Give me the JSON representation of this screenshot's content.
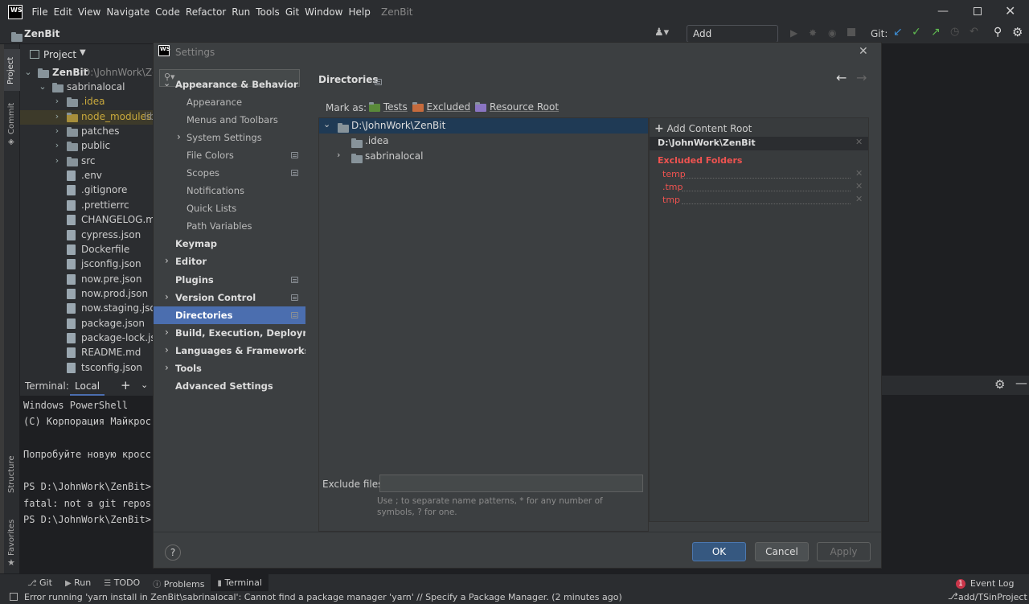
{
  "titlebar": {
    "logo": "WS",
    "menus": [
      "File",
      "Edit",
      "View",
      "Navigate",
      "Code",
      "Refactor",
      "Run",
      "Tools",
      "Git",
      "Window",
      "Help"
    ],
    "app": "ZenBit"
  },
  "toolbar": {
    "project": "ZenBit",
    "add_config": "Add Configuration...",
    "git_label": "Git:"
  },
  "sidebar_tabs": {
    "project": "Project",
    "commit": "Commit",
    "structure": "Structure",
    "favorites": "Favorites"
  },
  "project": {
    "header": "Project",
    "root": "ZenBit",
    "root_path": "D:\\JohnWork\\Zen",
    "items": [
      {
        "name": "sabrinalocal",
        "type": "folder",
        "level": 1
      },
      {
        "name": ".idea",
        "type": "folder",
        "level": 2
      },
      {
        "name": "node_modules",
        "suffix": "libr",
        "type": "folder",
        "level": 2
      },
      {
        "name": "patches",
        "type": "folder",
        "level": 2
      },
      {
        "name": "public",
        "type": "folder",
        "level": 2
      },
      {
        "name": "src",
        "type": "folder",
        "level": 2
      },
      {
        "name": ".env",
        "type": "file",
        "level": 2
      },
      {
        "name": ".gitignore",
        "type": "file",
        "level": 2
      },
      {
        "name": ".prettierrc",
        "type": "file",
        "level": 2
      },
      {
        "name": "CHANGELOG.md",
        "type": "file",
        "level": 2
      },
      {
        "name": "cypress.json",
        "type": "file",
        "level": 2
      },
      {
        "name": "Dockerfile",
        "type": "file",
        "level": 2
      },
      {
        "name": "jsconfig.json",
        "type": "file",
        "level": 2
      },
      {
        "name": "now.pre.json",
        "type": "file",
        "level": 2
      },
      {
        "name": "now.prod.json",
        "type": "file",
        "level": 2
      },
      {
        "name": "now.staging.json",
        "type": "file",
        "level": 2
      },
      {
        "name": "package.json",
        "type": "file",
        "level": 2
      },
      {
        "name": "package-lock.json",
        "type": "file",
        "level": 2
      },
      {
        "name": "README.md",
        "type": "file",
        "level": 2
      },
      {
        "name": "tsconfig.json",
        "type": "file",
        "level": 2
      }
    ]
  },
  "terminal": {
    "label": "Terminal:",
    "tab": "Local",
    "lines": [
      "Windows PowerShell",
      "(С) Корпорация Майкрос",
      "",
      "Попробуйте новую кросс",
      "",
      "PS D:\\JohnWork\\ZenBit>",
      "fatal: not a git repos",
      "PS D:\\JohnWork\\ZenBit>"
    ]
  },
  "settings": {
    "title": "Settings",
    "logo": "WS",
    "search_placeholder": "Q▾",
    "nav": [
      {
        "label": "Appearance & Behavior",
        "bold": true,
        "expanded": true,
        "level": 0
      },
      {
        "label": "Appearance",
        "level": 1
      },
      {
        "label": "Menus and Toolbars",
        "level": 1
      },
      {
        "label": "System Settings",
        "level": 1,
        "collapsed": true
      },
      {
        "label": "File Colors",
        "level": 1,
        "badge": true
      },
      {
        "label": "Scopes",
        "level": 1,
        "badge": true
      },
      {
        "label": "Notifications",
        "level": 1
      },
      {
        "label": "Quick Lists",
        "level": 1
      },
      {
        "label": "Path Variables",
        "level": 1
      },
      {
        "label": "Keymap",
        "bold": true,
        "level": 0
      },
      {
        "label": "Editor",
        "bold": true,
        "level": 0,
        "collapsed": true
      },
      {
        "label": "Plugins",
        "bold": true,
        "level": 0,
        "badge": true
      },
      {
        "label": "Version Control",
        "bold": true,
        "level": 0,
        "collapsed": true,
        "badge": true
      },
      {
        "label": "Directories",
        "bold": true,
        "level": 0,
        "selected": true,
        "badge": true
      },
      {
        "label": "Build, Execution, Deployment",
        "bold": true,
        "level": 0,
        "collapsed": true
      },
      {
        "label": "Languages & Frameworks",
        "bold": true,
        "level": 0,
        "collapsed": true
      },
      {
        "label": "Tools",
        "bold": true,
        "level": 0,
        "collapsed": true
      },
      {
        "label": "Advanced Settings",
        "bold": true,
        "level": 0
      }
    ],
    "page_title": "Directories",
    "mark_as": "Mark as:",
    "marks": [
      {
        "label": "Tests",
        "color": "#5a8a3a"
      },
      {
        "label": "Excluded",
        "color": "#c66b3d"
      },
      {
        "label": "Resource Root",
        "color": "#8a75c2"
      }
    ],
    "tree": {
      "root": "D:\\JohnWork\\ZenBit",
      "children": [
        ".idea",
        "sabrinalocal"
      ]
    },
    "add_root": "Add Content Root",
    "content_root": "D:\\JohnWork\\ZenBit",
    "excluded_header": "Excluded Folders",
    "excluded": [
      "temp",
      ".tmp",
      "tmp"
    ],
    "exclude_files_label": "Exclude files:",
    "exclude_files_value": "",
    "hint": "Use ; to separate name patterns, * for any number of symbols, ? for one.",
    "ok": "OK",
    "cancel": "Cancel",
    "apply": "Apply",
    "help": "?"
  },
  "bottom_tabs": [
    {
      "label": "Git"
    },
    {
      "label": "Run"
    },
    {
      "label": "TODO"
    },
    {
      "label": "Problems"
    },
    {
      "label": "Terminal",
      "active": true
    }
  ],
  "event_log": {
    "count": "1",
    "label": "Event Log"
  },
  "status": {
    "message": "Error running 'yarn install in ZenBit\\sabrinalocal': Cannot find a package manager 'yarn' // Specify a Package Manager. (2 minutes ago)",
    "branch": "add/TSinProject"
  },
  "colors": {
    "accent": "#4b6eaf",
    "excluded_red": "#ef5350",
    "ok_button": "#365880"
  }
}
